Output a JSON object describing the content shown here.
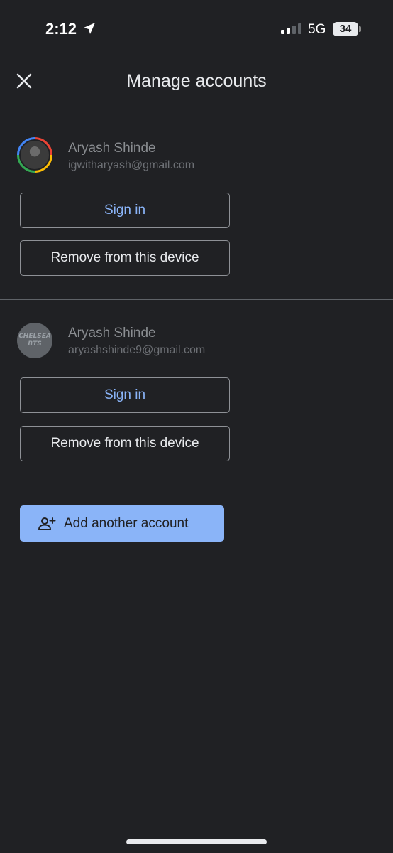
{
  "status_bar": {
    "time": "2:12",
    "network": "5G",
    "battery": "34",
    "icons": [
      "location-arrow-icon",
      "signal-icon"
    ]
  },
  "header": {
    "title": "Manage accounts",
    "close_icon": "close-icon"
  },
  "accounts": [
    {
      "name": "Aryash Shinde",
      "email": "igwitharyash@gmail.com",
      "sign_in_label": "Sign in",
      "remove_label": "Remove from this device"
    },
    {
      "name": "Aryash Shinde",
      "email": "aryashshinde9@gmail.com",
      "avatar_text": [
        "CHELSEA",
        "BTS"
      ],
      "sign_in_label": "Sign in",
      "remove_label": "Remove from this device"
    }
  ],
  "add_account": {
    "label": "Add another account",
    "icon": "add-person-icon"
  },
  "colors": {
    "background": "#202124",
    "accent": "#8ab4f8",
    "divider": "#5f6368"
  }
}
